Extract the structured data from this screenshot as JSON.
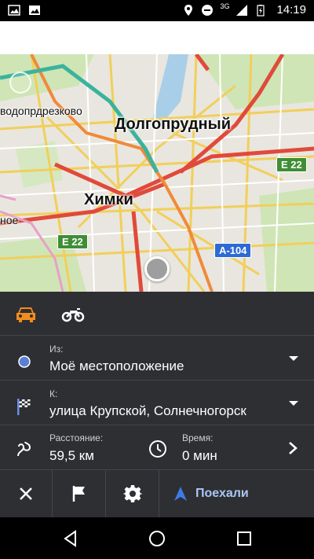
{
  "status_bar": {
    "time": "14:19",
    "network_label": "3G",
    "icons": [
      "image-icon",
      "image-icon",
      "location-icon",
      "dnd-icon",
      "signal-icon",
      "battery-charging-icon"
    ]
  },
  "map": {
    "labels": {
      "dolgoprudny": "Долгопрудный",
      "khimki": "Химки",
      "vodo": "водопрдрезково",
      "noe": "ное"
    },
    "shields": {
      "e22_top": "E 22",
      "e22_left": "E 22",
      "a104": "A-104"
    }
  },
  "route_panel": {
    "modes": [
      "car-icon",
      "motorcycle-icon"
    ],
    "active_mode": "car",
    "accent_color": "#f28c1e",
    "from": {
      "label": "Из:",
      "value": "Моё местоположение"
    },
    "to": {
      "label": "К:",
      "value": "улица Крупской, Солнечногорск"
    },
    "distance": {
      "label": "Расстояние:",
      "value": "59,5 км"
    },
    "time": {
      "label": "Время:",
      "value": "0 мин"
    },
    "go_label": "Поехали"
  }
}
